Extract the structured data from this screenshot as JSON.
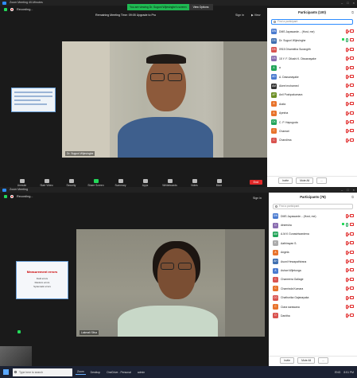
{
  "window1": {
    "title": "Zoom Meeting 40-Minutes",
    "recording": "Recording...",
    "banner_prefix": "You are viewing Dr. Suguni Wijesinghe's screen",
    "banner_options": "View Options",
    "timer": "Remaining Meeting Time: 09:05 Upgrade to Pro",
    "sign_in": "Sign in",
    "view": "View",
    "speaker_name": "Dr. Suguni Wijesinghe",
    "toolbar": [
      "Unmute",
      "Start Video",
      "Security",
      "Share Screen",
      "Summary",
      "Apps",
      "Whiteboards",
      "Notes",
      "More"
    ],
    "end": "End",
    "participants": {
      "title": "Participants (100)",
      "find_placeholder": "Find a participant",
      "list": [
        {
          "initials": "DW",
          "color": "#4a7bd0",
          "name": "DMS Jayawarde... (Host, me)",
          "mic": "off",
          "cam": "off",
          "green": false
        },
        {
          "initials": "DS",
          "color": "#3f6fb0",
          "name": "Dr. Suguni Wijesinghe",
          "mic": "on",
          "cam": "off",
          "green": true
        },
        {
          "initials": "DS",
          "color": "#d9534f",
          "name": "0915 Dharmitha Surangith",
          "mic": "off",
          "cam": "off",
          "green": false
        },
        {
          "initials": "DS",
          "color": "#8a6db0",
          "name": "15 Y. F. Dilushi K. Dissanayake",
          "mic": "off",
          "cam": "off",
          "green": false
        },
        {
          "initials": "A",
          "color": "#23a55a",
          "name": "a",
          "mic": "off",
          "cam": "off",
          "green": false
        },
        {
          "initials": "AD",
          "color": "#4a7bd0",
          "name": "A. Dassanayake",
          "mic": "off",
          "cam": "off",
          "green": false
        },
        {
          "initials": "AM",
          "color": "#333333",
          "name": "Akeel mohamed",
          "mic": "off",
          "cam": "off",
          "green": false
        },
        {
          "initials": "AP",
          "color": "#6b8e23",
          "name": "Anil Pushpakumara",
          "mic": "off",
          "cam": "off",
          "green": false
        },
        {
          "initials": "A",
          "color": "#e8732c",
          "name": "Arafa",
          "mic": "off",
          "cam": "off",
          "green": false
        },
        {
          "initials": "A",
          "color": "#e8732c",
          "name": "Ayesha",
          "mic": "off",
          "cam": "off",
          "green": false
        },
        {
          "initials": "CK",
          "color": "#23a55a",
          "name": "C. P. Hapugoda",
          "mic": "off",
          "cam": "off",
          "green": false
        },
        {
          "initials": "C",
          "color": "#e8732c",
          "name": "Chamari",
          "mic": "off",
          "cam": "off",
          "green": false
        },
        {
          "initials": "C",
          "color": "#d9534f",
          "name": "Chandima",
          "mic": "off",
          "cam": "off",
          "green": false
        }
      ],
      "invite": "Invite",
      "mute_all": "Mute All",
      "more": "..."
    }
  },
  "window2": {
    "title": "Zoom Meeting",
    "recording": "Recording...",
    "sign_in": "Sign in",
    "speaker_name": "Lakmali Silva",
    "slide_title": "Measurement errors",
    "slide_lines": [
      "Field errors",
      "Random errors",
      "Systematic errors"
    ],
    "participants": {
      "title": "Participants (78)",
      "find_placeholder": "Find a participant",
      "list": [
        {
          "initials": "DW",
          "color": "#4a7bd0",
          "name": "DMS Jayawarde... (Host, me)",
          "mic": "off",
          "cam": "off",
          "green": false
        },
        {
          "initials": "D",
          "color": "#8a6db0",
          "name": "dineesha",
          "mic": "on",
          "cam": "off",
          "green": true
        },
        {
          "initials": "AM",
          "color": "#23a55a",
          "name": "A.M.K Gunasiriwardena",
          "mic": "off",
          "cam": "off",
          "green": false
        },
        {
          "initials": "K",
          "color": "#aaaaaa",
          "name": "Aathirayan S.",
          "mic": "off",
          "cam": "off",
          "green": false
        },
        {
          "initials": "A",
          "color": "#e8732c",
          "name": "Angela",
          "mic": "off",
          "cam": "off",
          "green": false
        },
        {
          "initials": "AH",
          "color": "#3f6fb0",
          "name": "Asuni Hewapathirana",
          "mic": "off",
          "cam": "off",
          "green": false
        },
        {
          "initials": "A",
          "color": "#4a7bd0",
          "name": "Ashan Wijetunga",
          "mic": "off",
          "cam": "off",
          "green": false
        },
        {
          "initials": "C",
          "color": "#d9534f",
          "name": "Chameera Gallage",
          "mic": "off",
          "cam": "off",
          "green": false
        },
        {
          "initials": "C",
          "color": "#e8732c",
          "name": "Chaminda Kumara",
          "mic": "off",
          "cam": "off",
          "green": false
        },
        {
          "initials": "CG",
          "color": "#d9534f",
          "name": "Chathurika Gajanayaka",
          "mic": "off",
          "cam": "off",
          "green": false
        },
        {
          "initials": "C",
          "color": "#e8732c",
          "name": "Ciara sarawana",
          "mic": "off",
          "cam": "off",
          "green": false
        },
        {
          "initials": "D",
          "color": "#d9534f",
          "name": "Danitha",
          "mic": "off",
          "cam": "off",
          "green": false
        }
      ],
      "invite": "Invite",
      "mute_all": "Mute All",
      "more": "..."
    }
  },
  "taskbar": {
    "search_placeholder": "Type here to search",
    "apps": [
      "Zoom",
      "Desktop",
      "OneDrive - Personal",
      "admin"
    ],
    "tray": [
      "ENG",
      "8:51 PM"
    ]
  }
}
